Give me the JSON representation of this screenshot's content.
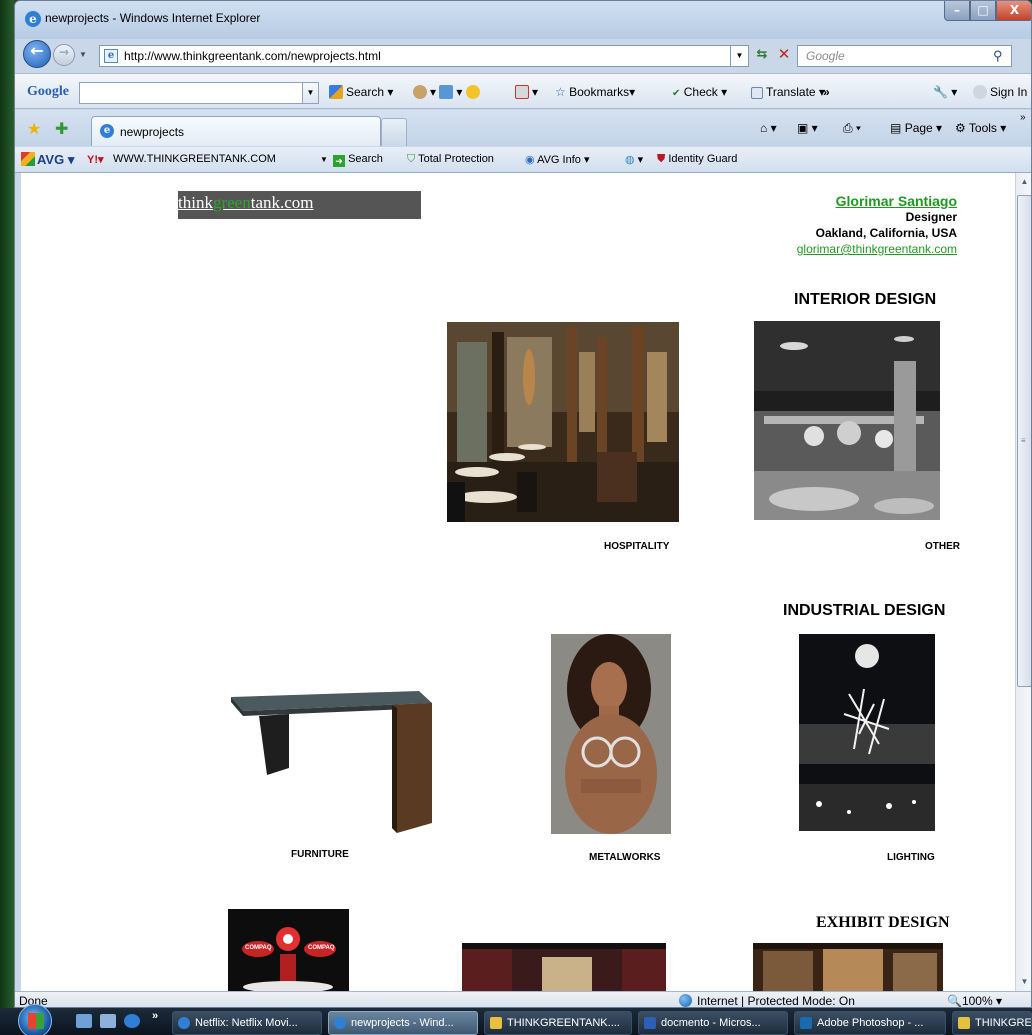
{
  "window": {
    "title": "newprojects - Windows Internet Explorer",
    "minimize": "–",
    "maximize": "□",
    "close": "X"
  },
  "address_bar": {
    "url": "http://www.thinkgreentank.com/newprojects.html",
    "search_placeholder": "Google"
  },
  "google_toolbar": {
    "logo": "Google",
    "items": {
      "search": "Search",
      "bookmarks": "Bookmarks",
      "check": "Check",
      "translate": "Translate",
      "more": "»",
      "sign_in": "Sign In"
    }
  },
  "tab_bar": {
    "tab_title": "newprojects",
    "commands": {
      "page": "Page",
      "tools": "Tools",
      "more": "»"
    }
  },
  "avg_toolbar": {
    "logo": "AVG",
    "search_value": "WWW.THINKGREENTANK.COM",
    "search": "Search",
    "total_protection": "Total Protection",
    "avg_info": "AVG Info",
    "identity_guard": "Identity Guard"
  },
  "page": {
    "logo": {
      "part1": "think",
      "part2": "green",
      "part3": "tank.com"
    },
    "contact": {
      "name": "Glorimar Santiago",
      "role": "Designer",
      "location": "Oakland, California, USA",
      "email": "glorimar@thinkgreentank.com"
    },
    "sections": {
      "interior": "INTERIOR DESIGN",
      "industrial": "INDUSTRIAL DESIGN",
      "exhibit": "EXHIBIT DESIGN"
    },
    "captions": {
      "hospitality": "HOSPITALITY",
      "other": "OTHER",
      "furniture": "FURNITURE",
      "metalworks": "METALWORKS",
      "lighting": "LIGHTING"
    },
    "exhibit_sign": "COMPAQ"
  },
  "status_bar": {
    "status": "Done",
    "zone": "Internet | Protected Mode: On",
    "zoom": "100%"
  },
  "taskbar": {
    "tasks": [
      "Netflix: Netflix Movi...",
      "newprojects - Wind...",
      "THINKGREENTANK....",
      "docmento - Micros...",
      "Adobe Photoshop - ...",
      "THINKGREE"
    ],
    "more": "»"
  }
}
